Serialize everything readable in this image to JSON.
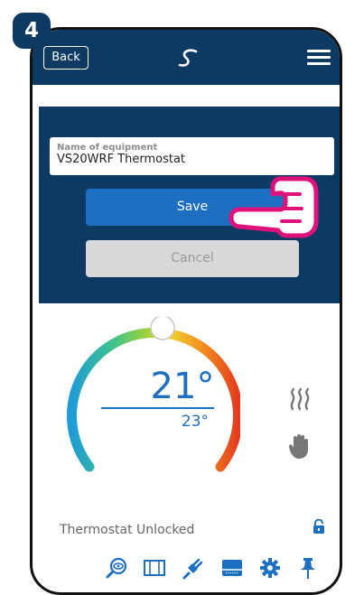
{
  "step_number": "4",
  "header": {
    "back_label": "Back",
    "logo": "salus-logo-icon",
    "menu": "hamburger-menu-icon"
  },
  "edit_form": {
    "field_label": "Name of equipment",
    "field_value": "VS20WRF Thermostat",
    "save_label": "Save",
    "cancel_label": "Cancel"
  },
  "thermostat": {
    "current_temp": "21°",
    "target_temp": "23°",
    "status": "Thermostat Unlocked",
    "mode_icons": [
      "heating-icon",
      "manual-hand-icon"
    ],
    "lock_icon": "padlock-icon"
  },
  "toolbar": {
    "icons": [
      "search-eye-icon",
      "schedule-icon",
      "plug-icon",
      "display-icon",
      "settings-icon",
      "pin-icon"
    ]
  },
  "colors": {
    "header_bg": "#0d3a63",
    "accent": "#1c6fc1",
    "highlight": "#e0117a"
  }
}
